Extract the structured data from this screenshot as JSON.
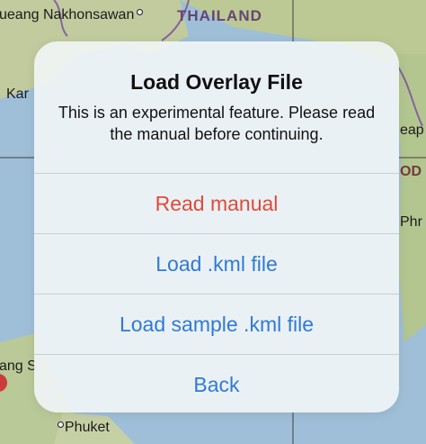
{
  "map": {
    "labels": {
      "nakhonsawan": "ueang Nakhonsawan",
      "thailand": "THAILAND",
      "kar": "Kar",
      "eap": "eap",
      "od": "OD",
      "phr": "Phr",
      "ang_s": "ang S",
      "phuket": "Phuket"
    }
  },
  "alert": {
    "title": "Load Overlay File",
    "message": "This is an experimental feature. Please read the manual before continuing.",
    "buttons": {
      "read_manual": "Read manual",
      "load_kml": "Load .kml file",
      "load_sample_kml": "Load sample .kml file",
      "back": "Back"
    },
    "colors": {
      "action": "#2f7ad6",
      "destructive": "#e04a3b"
    }
  }
}
